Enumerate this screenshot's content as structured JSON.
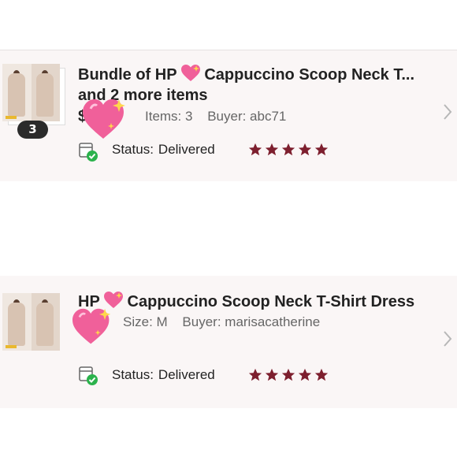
{
  "orders": [
    {
      "title_prefix": "Bundle of HP",
      "title_suffix": "Cappuccino Scoop Neck T...",
      "title_line2": "and 2 more items",
      "price_fragment": "$",
      "meta": [
        "Items: 3",
        "Buyer: abc71"
      ],
      "count_badge": "3",
      "status_label": "Status:",
      "status_value": "Delivered",
      "rating": 5,
      "icons": [
        "thumbnail-stack",
        "sparkling-heart-icon",
        "package-delivered-icon",
        "star-icon",
        "chevron-right-icon"
      ]
    },
    {
      "title_prefix": "HP",
      "title_suffix": "Cappuccino Scoop Neck T-Shirt Dress",
      "meta": [
        "Size: M",
        "Buyer: marisacatherine"
      ],
      "status_label": "Status:",
      "status_value": "Delivered",
      "rating": 5,
      "icons": [
        "thumbnail",
        "sparkling-heart-icon",
        "package-delivered-icon",
        "star-icon",
        "chevron-right-icon"
      ]
    }
  ],
  "colors": {
    "card_bg": "#faf6f6",
    "star": "#7d1f2e",
    "check": "#2bb24c",
    "heart": "#f0609a",
    "chevron": "#b7b7b7"
  }
}
